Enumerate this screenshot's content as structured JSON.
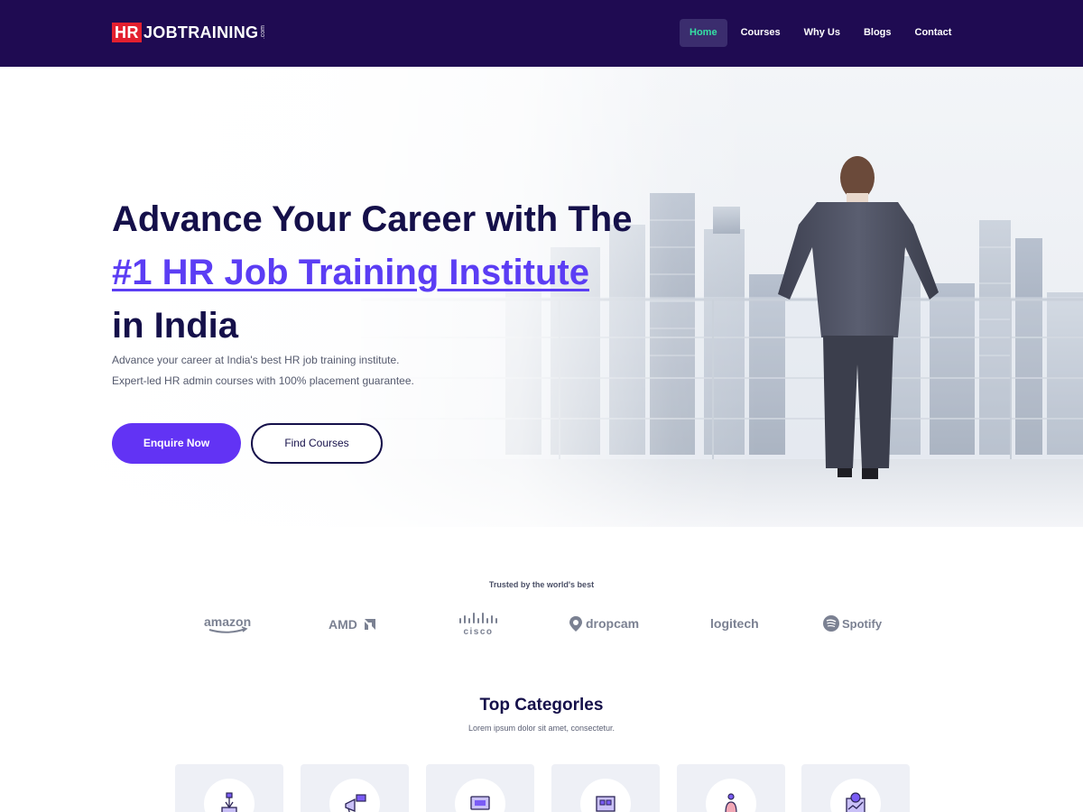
{
  "header": {
    "logo_hr": "HR",
    "logo_text": "JOBTRAINING",
    "logo_com": ".com",
    "nav": [
      {
        "label": "Home",
        "active": true
      },
      {
        "label": "Courses",
        "active": false
      },
      {
        "label": "Why Us",
        "active": false
      },
      {
        "label": "Blogs",
        "active": false
      },
      {
        "label": "Contact",
        "active": false
      }
    ]
  },
  "hero": {
    "title_line1": "Advance Your Career with The",
    "title_accent": "#1 HR Job Training Institute",
    "title_line3": "in India",
    "subtitle_line1": "Advance your career at India's best HR job training institute.",
    "subtitle_line2": "Expert-led HR admin courses with 100% placement guarantee.",
    "primary_button": "Enquire Now",
    "secondary_button": "Find Courses"
  },
  "trusted": {
    "label": "Trusted by the world's best",
    "brands": [
      {
        "name": "amazon",
        "icon": "amazon-logo"
      },
      {
        "name": "AMD",
        "icon": "amd-logo"
      },
      {
        "name": "cisco",
        "icon": "cisco-logo"
      },
      {
        "name": "dropcam",
        "icon": "dropcam-logo"
      },
      {
        "name": "logitech",
        "icon": "logitech-logo"
      },
      {
        "name": "Spotify",
        "icon": "spotify-logo"
      }
    ]
  },
  "categories": {
    "title": "Top Categorles",
    "subtitle": "Lorem ipsum dolor sit amet, consectetur.",
    "icons": [
      "design-icon",
      "marketing-icon",
      "computer-icon",
      "blueprint-icon",
      "person-icon",
      "finance-icon"
    ]
  },
  "colors": {
    "header_bg": "#1f0b52",
    "accent": "#5b3df4",
    "nav_active": "#35e0a4",
    "logo_red": "#e3202f"
  }
}
